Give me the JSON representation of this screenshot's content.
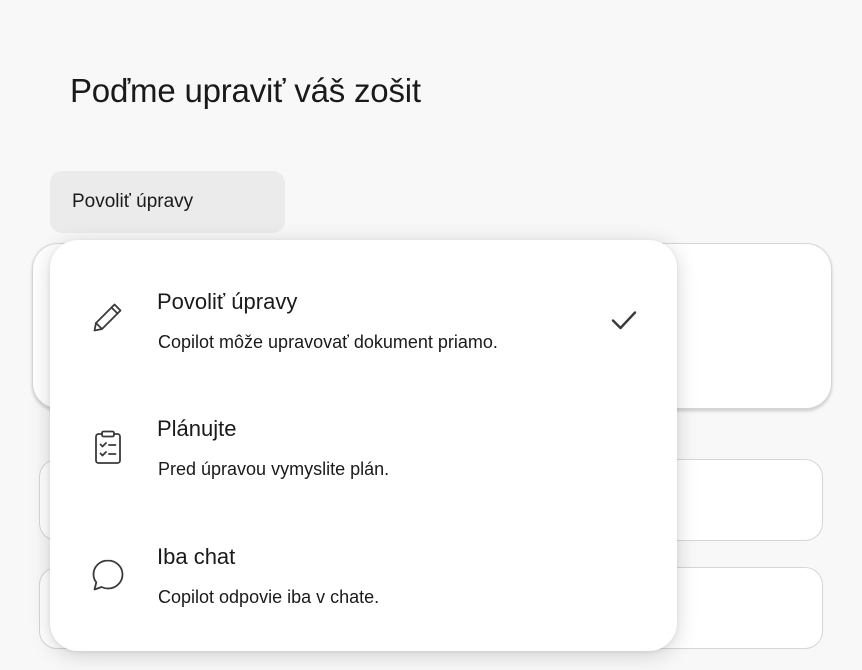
{
  "header": {
    "title": "Poďme upraviť váš zošit"
  },
  "mode_button": {
    "label": "Povoliť úpravy"
  },
  "menu": {
    "items": [
      {
        "title": "Povoliť úpravy",
        "description": "Copilot môže upravovať dokument priamo.",
        "icon": "pencil-icon",
        "selected": true
      },
      {
        "title": "Plánujte",
        "description": "Pred úpravou vymyslite plán.",
        "icon": "clipboard-checklist-icon",
        "selected": false
      },
      {
        "title": "Iba chat",
        "description": "Copilot odpovie iba v chate.",
        "icon": "chat-bubble-icon",
        "selected": false
      }
    ]
  },
  "colors": {
    "background": "#f8f8f8",
    "button_bg": "#ebebeb",
    "menu_bg": "#ffffff",
    "text": "#1a1a1a"
  }
}
